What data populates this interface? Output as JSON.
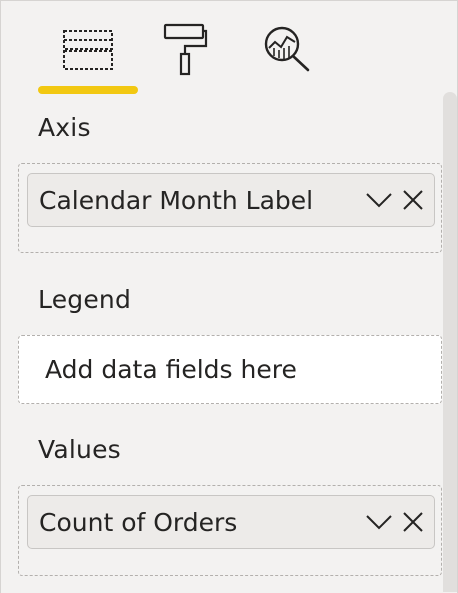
{
  "tabs": [
    {
      "name": "fields",
      "icon": "fields-icon"
    },
    {
      "name": "format",
      "icon": "paint-roller-icon"
    },
    {
      "name": "analytics",
      "icon": "analytics-magnifier-icon"
    }
  ],
  "active_tab_accent": "#f2c811",
  "sections": {
    "axis": {
      "label": "Axis",
      "field": "Calendar Month Label"
    },
    "legend": {
      "label": "Legend",
      "placeholder": "Add data fields here"
    },
    "values": {
      "label": "Values",
      "field": "Count of Orders"
    }
  }
}
